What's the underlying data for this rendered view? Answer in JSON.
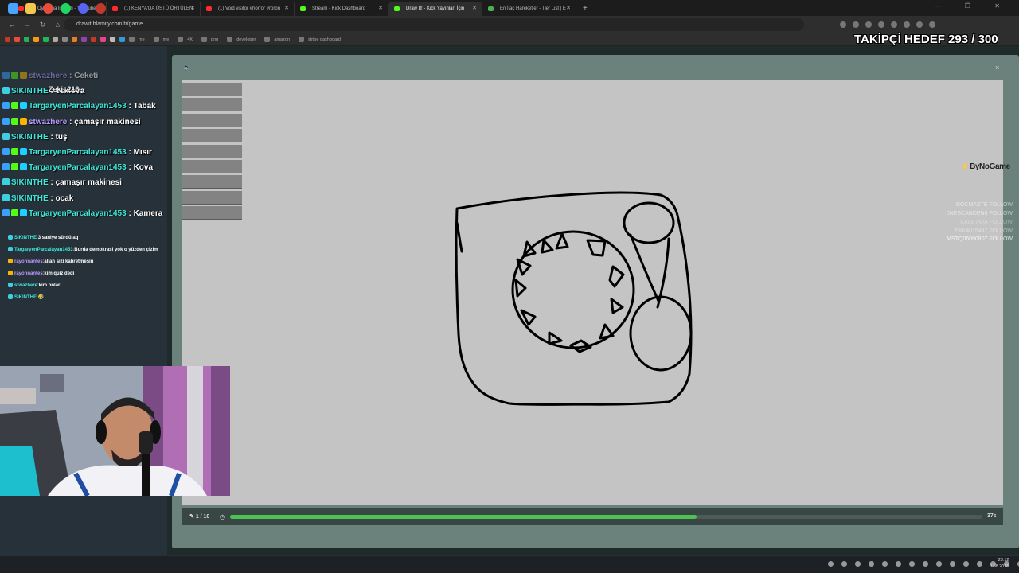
{
  "tabs": [
    {
      "label": "(1) Oynatma listeleri - YouTube",
      "color": "#ff2b2b"
    },
    {
      "label": "(1) KENYA'DA ÜSTÜ ÖRTÜLEN",
      "color": "#ff2b2b"
    },
    {
      "label": "(1) Void visitor #horror #roron",
      "color": "#ff2b2b"
    },
    {
      "label": "Stream - Kick Dashboard",
      "color": "#53fc18"
    },
    {
      "label": "Draw It! - Kick Yayınları İçin",
      "color": "#53fc18",
      "active": true
    },
    {
      "label": "En İlaç Hareketler - Tier List | E",
      "color": "#4caf50"
    }
  ],
  "new_tab_label": "+",
  "window_controls": "— ❐ ✕",
  "nav": {
    "back": "←",
    "forward": "→",
    "reload": "↻",
    "home": "⌂",
    "url": "drawit.blamity.com/tr/game"
  },
  "bookmarks": [
    "me",
    "me",
    "4K",
    "png",
    "developer",
    "amazon",
    "stripe dashboard"
  ],
  "overlay_follow_goal": "TAKİPÇİ HEDEF 293 / 300",
  "chat_overlay": [
    {
      "user": "stwazhere",
      "msg": "Ceketi",
      "faded": true
    },
    {
      "user": "SIKINTHE",
      "msg": "eskiova",
      "overlap": "Zeki: 216"
    },
    {
      "user": "TargaryenParcalayan1453",
      "msg": "Tabak"
    },
    {
      "user": "stwazhere",
      "msg": "çamaşır makinesi"
    },
    {
      "user": "SIKINTHE",
      "msg": "tuş"
    },
    {
      "user": "TargaryenParcalayan1453",
      "msg": "Mısır"
    },
    {
      "user": "TargaryenParcalayan1453",
      "msg": "Kova"
    },
    {
      "user": "SIKINTHE",
      "msg": "çamaşır makinesi"
    },
    {
      "user": "SIKINTHE",
      "msg": "ocak"
    },
    {
      "user": "TargaryenParcalayan1453",
      "msg": "Kamera"
    }
  ],
  "chat_panel": [
    {
      "user": "SIKINTHE",
      "msg": "3 saniye sürdü aq"
    },
    {
      "user": "TargaryenParcalayan1453",
      "msg": "Burda demokrasi yok o yüzden çizim"
    },
    {
      "user": "rayonnantes",
      "msg": "allah sizi kahretmesin"
    },
    {
      "user": "rayonnantes",
      "msg": "kim quiz dedi"
    },
    {
      "user": "stwazhere",
      "msg": "kim onlar"
    },
    {
      "user": "SIKINTHE",
      "msg": "🤣"
    }
  ],
  "modal": {
    "speaker_icon": "🔈",
    "close_icon": "×"
  },
  "brand": "ByNoGame",
  "follow_list": [
    "ROCMASTE FOLLOW",
    "0NESCANDEN0 FOLLOW",
    "KALETAVA FOLLOW",
    "EXK4015447 FOLLOW",
    "MSTQ06090807 FOLLOW"
  ],
  "bottom": {
    "round": "1 / 10",
    "time_left": "37s",
    "progress": 0.62
  },
  "clock": {
    "time": "23:12",
    "date": "3.08.2026"
  },
  "colors": {
    "progress": "#4cc252",
    "canvas": "#c4c4c4",
    "name_teal": "#3ee8d8"
  }
}
